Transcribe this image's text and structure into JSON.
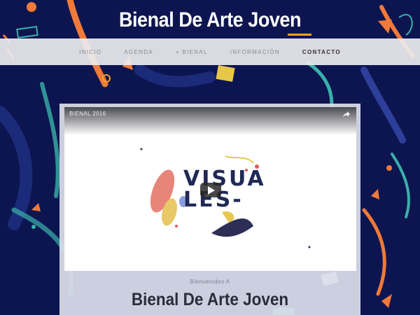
{
  "site": {
    "title": "Bienal De Arte Joven"
  },
  "nav": {
    "items": [
      {
        "label": "INICIO"
      },
      {
        "label": "AGENDA"
      },
      {
        "label": "+ BIENAL"
      },
      {
        "label": "INFORMACIÓN"
      },
      {
        "label": "CONTACTO"
      }
    ],
    "active": "CONTACTO"
  },
  "video": {
    "title": "BIENAL 2016",
    "artwork_line1": "VISUA",
    "artwork_line2": "LES-"
  },
  "welcome": {
    "subtitle": "Bienvenidos A",
    "title": "Bienal De Arte Joven"
  },
  "colors": {
    "background": "#0d1550",
    "accent_orange": "#f07a3a",
    "accent_teal": "#3ab0a8",
    "navbar": "#ececf0"
  },
  "icons": [
    "share-icon",
    "play-icon"
  ]
}
